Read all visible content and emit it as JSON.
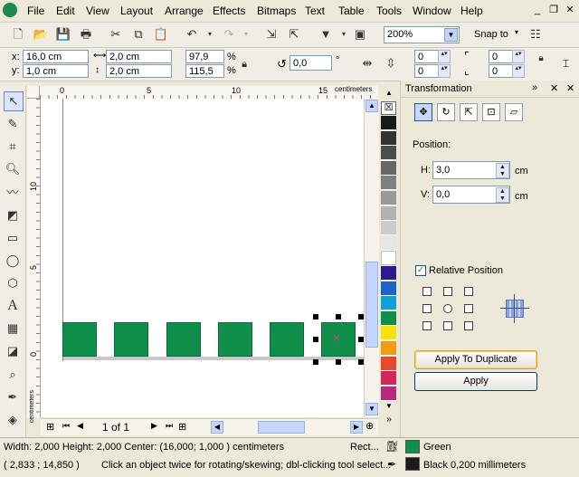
{
  "menu": [
    "File",
    "Edit",
    "View",
    "Layout",
    "Arrange",
    "Effects",
    "Bitmaps",
    "Text",
    "Table",
    "Tools",
    "Window",
    "Help"
  ],
  "window_controls": {
    "minimize": "_",
    "restore": "❐",
    "close": "✕"
  },
  "standard_toolbar": {
    "zoom": "200%",
    "snap_to": "Snap to"
  },
  "property_bar": {
    "x": "16,0 cm",
    "y": "1,0 cm",
    "width": "2,0 cm",
    "height": "2,0 cm",
    "scale_w": "97,9",
    "scale_h": "115,5",
    "pct": "%",
    "rotation": "0,0",
    "degree": "°",
    "dup_x": "0",
    "dup_y": "0",
    "dup_x2": "0",
    "dup_y2": "0"
  },
  "ruler": {
    "unit": "centimeters",
    "h_ticks": [
      "0",
      "5",
      "10",
      "15"
    ],
    "v_ticks": [
      "10",
      "5",
      "0"
    ],
    "v_unit": "centimeters"
  },
  "page_nav": {
    "label": "1 of 1"
  },
  "docker": {
    "title": "Transformation",
    "section_label": "Position:",
    "h_label": "H:",
    "h_value": "3,0",
    "h_unit": "cm",
    "v_label": "V:",
    "v_value": "0,0",
    "v_unit": "cm",
    "relative_label": "Relative Position",
    "relative_checked": true,
    "apply_dup": "Apply To Duplicate",
    "apply": "Apply"
  },
  "palette_colors": [
    "#1a1a1a",
    "#333333",
    "#4d4d4d",
    "#666666",
    "#808080",
    "#999999",
    "#b3b3b3",
    "#cccccc",
    "#e6e6e6",
    "#ffffff",
    "#2e1a8e",
    "#1e63c7",
    "#12a0d8",
    "#108f4a",
    "#f5e30b",
    "#f39c12",
    "#e8492c",
    "#d3265a",
    "#b52b7d"
  ],
  "status": {
    "dimensions": "Width: 2,000  Height: 2,000  Center: (16,000; 1,000 )  centimeters",
    "object_type": "Rect...",
    "fill_name": "Green",
    "fill_color": "#108f4a",
    "outline": "Black  0,200 millimeters",
    "cursor": "( 2,833 ; 14,850 )",
    "hint": "Click an object twice for rotating/skewing; dbl-clicking tool select..."
  }
}
